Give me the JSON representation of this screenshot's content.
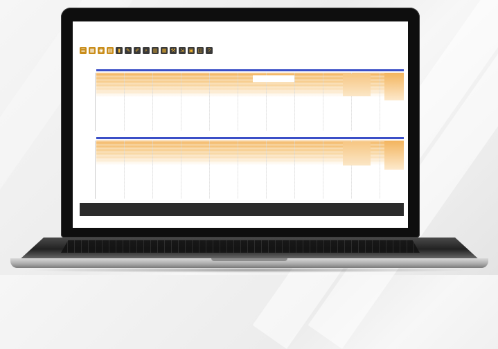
{
  "app": {
    "title": "",
    "toolbar": [
      {
        "icon": "list-icon",
        "label": "",
        "lit": true
      },
      {
        "icon": "grid-icon",
        "label": "",
        "lit": true
      },
      {
        "icon": "eye-icon",
        "label": "",
        "lit": true
      },
      {
        "icon": "document-icon",
        "label": "",
        "lit": true
      },
      {
        "icon": "bookmark-icon",
        "label": "",
        "lit": false
      },
      {
        "icon": "edit-icon",
        "label": "",
        "lit": false
      },
      {
        "icon": "pen-icon",
        "label": "",
        "lit": false
      },
      {
        "icon": "zoom-icon",
        "label": "",
        "lit": false
      },
      {
        "icon": "chart-icon",
        "label": "",
        "lit": false
      },
      {
        "icon": "table-icon",
        "label": "",
        "lit": false
      },
      {
        "icon": "wrench-icon",
        "label": "",
        "lit": false
      },
      {
        "icon": "export-icon",
        "label": "",
        "lit": false
      },
      {
        "icon": "layout-icon",
        "label": "",
        "lit": false
      },
      {
        "icon": "split-icon",
        "label": "",
        "lit": false
      },
      {
        "icon": "help-icon",
        "label": "",
        "lit": false
      }
    ],
    "panels": [
      {
        "side_label": "",
        "row_labels": [
          "",
          ""
        ],
        "ruler": [
          "",
          "",
          "",
          "",
          "",
          "",
          "",
          "",
          ""
        ]
      },
      {
        "side_label": "",
        "row_labels": [
          "",
          ""
        ],
        "ruler": [
          "",
          "",
          "",
          "",
          "",
          "",
          "",
          "",
          ""
        ]
      }
    ],
    "status": {
      "left_labels": [
        "",
        ""
      ],
      "left_values": [
        "",
        ""
      ],
      "middle": "",
      "right_labels": [
        "",
        "",
        ""
      ],
      "right_values": [
        "",
        "",
        ""
      ]
    }
  },
  "colors": {
    "accent": "#e0a63a",
    "sequence_bar": "#3b4fc7",
    "read_fill": "#f3b45d"
  }
}
